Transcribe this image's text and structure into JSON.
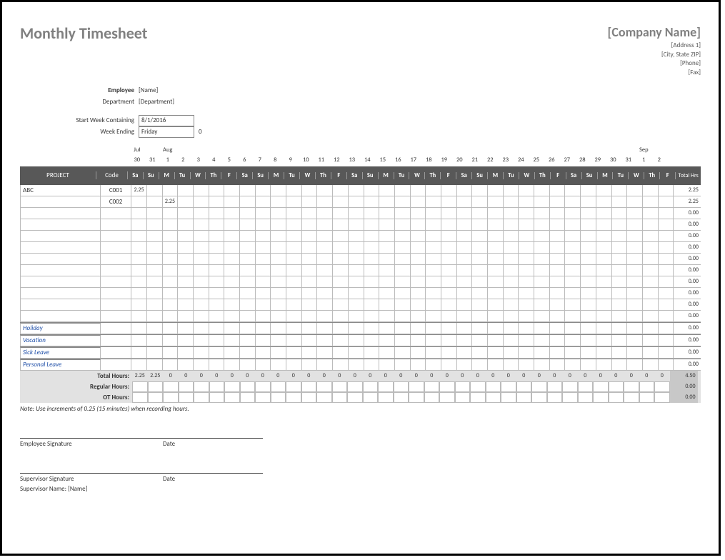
{
  "title": "Monthly Timesheet",
  "company": {
    "name": "[Company Name]",
    "addr1": "[Address 1]",
    "addr2": "[City, State ZIP]",
    "phone": "[Phone]",
    "fax": "[Fax]"
  },
  "meta": {
    "emp_lbl": "Employee",
    "emp_val": "[Name]",
    "dept_lbl": "Department",
    "dept_val": "[Department]",
    "start_lbl": "Start Week Containing",
    "start_val": "8/1/2016",
    "end_lbl": "Week Ending",
    "end_val": "Friday",
    "end_num": "0"
  },
  "months": [
    "Jul",
    "",
    "Aug",
    "",
    "",
    "",
    "",
    "",
    "",
    "",
    "",
    "",
    "",
    "",
    "",
    "",
    "",
    "",
    "",
    "",
    "",
    "",
    "",
    "",
    "",
    "",
    "",
    "",
    "",
    "",
    "",
    "",
    "",
    "Sep",
    ""
  ],
  "dates": [
    "30",
    "31",
    "1",
    "2",
    "3",
    "4",
    "5",
    "6",
    "7",
    "8",
    "9",
    "10",
    "11",
    "12",
    "13",
    "14",
    "15",
    "16",
    "17",
    "18",
    "19",
    "20",
    "21",
    "22",
    "23",
    "24",
    "25",
    "26",
    "27",
    "28",
    "29",
    "30",
    "31",
    "1",
    "2"
  ],
  "dow": [
    "Sa",
    "Su",
    "M",
    "Tu",
    "W",
    "Th",
    "F",
    "Sa",
    "Su",
    "M",
    "Tu",
    "W",
    "Th",
    "F",
    "Sa",
    "Su",
    "M",
    "Tu",
    "W",
    "Th",
    "F",
    "Sa",
    "Su",
    "M",
    "Tu",
    "W",
    "Th",
    "F",
    "Sa",
    "Su",
    "M",
    "Tu",
    "W",
    "Th",
    "F"
  ],
  "hdr": {
    "project": "PROJECT",
    "code": "Code",
    "total": "Total Hrs"
  },
  "rows": [
    {
      "project": "ABC",
      "code": "C001",
      "cells": [
        "2.25",
        "",
        "",
        "",
        "",
        "",
        "",
        "",
        "",
        "",
        "",
        "",
        "",
        "",
        "",
        "",
        "",
        "",
        "",
        "",
        "",
        "",
        "",
        "",
        "",
        "",
        "",
        "",
        "",
        "",
        "",
        "",
        "",
        "",
        ""
      ],
      "total": "2.25"
    },
    {
      "project": "",
      "code": "C002",
      "cells": [
        "",
        "",
        "2.25",
        "",
        "",
        "",
        "",
        "",
        "",
        "",
        "",
        "",
        "",
        "",
        "",
        "",
        "",
        "",
        "",
        "",
        "",
        "",
        "",
        "",
        "",
        "",
        "",
        "",
        "",
        "",
        "",
        "",
        "",
        "",
        ""
      ],
      "total": "2.25"
    },
    {
      "project": "",
      "code": "",
      "cells": [
        "",
        "",
        "",
        "",
        "",
        "",
        "",
        "",
        "",
        "",
        "",
        "",
        "",
        "",
        "",
        "",
        "",
        "",
        "",
        "",
        "",
        "",
        "",
        "",
        "",
        "",
        "",
        "",
        "",
        "",
        "",
        "",
        "",
        "",
        ""
      ],
      "total": "0.00"
    },
    {
      "project": "",
      "code": "",
      "cells": [
        "",
        "",
        "",
        "",
        "",
        "",
        "",
        "",
        "",
        "",
        "",
        "",
        "",
        "",
        "",
        "",
        "",
        "",
        "",
        "",
        "",
        "",
        "",
        "",
        "",
        "",
        "",
        "",
        "",
        "",
        "",
        "",
        "",
        "",
        ""
      ],
      "total": "0.00"
    },
    {
      "project": "",
      "code": "",
      "cells": [
        "",
        "",
        "",
        "",
        "",
        "",
        "",
        "",
        "",
        "",
        "",
        "",
        "",
        "",
        "",
        "",
        "",
        "",
        "",
        "",
        "",
        "",
        "",
        "",
        "",
        "",
        "",
        "",
        "",
        "",
        "",
        "",
        "",
        "",
        ""
      ],
      "total": "0.00"
    },
    {
      "project": "",
      "code": "",
      "cells": [
        "",
        "",
        "",
        "",
        "",
        "",
        "",
        "",
        "",
        "",
        "",
        "",
        "",
        "",
        "",
        "",
        "",
        "",
        "",
        "",
        "",
        "",
        "",
        "",
        "",
        "",
        "",
        "",
        "",
        "",
        "",
        "",
        "",
        "",
        ""
      ],
      "total": "0.00"
    },
    {
      "project": "",
      "code": "",
      "cells": [
        "",
        "",
        "",
        "",
        "",
        "",
        "",
        "",
        "",
        "",
        "",
        "",
        "",
        "",
        "",
        "",
        "",
        "",
        "",
        "",
        "",
        "",
        "",
        "",
        "",
        "",
        "",
        "",
        "",
        "",
        "",
        "",
        "",
        "",
        ""
      ],
      "total": "0.00"
    },
    {
      "project": "",
      "code": "",
      "cells": [
        "",
        "",
        "",
        "",
        "",
        "",
        "",
        "",
        "",
        "",
        "",
        "",
        "",
        "",
        "",
        "",
        "",
        "",
        "",
        "",
        "",
        "",
        "",
        "",
        "",
        "",
        "",
        "",
        "",
        "",
        "",
        "",
        "",
        "",
        ""
      ],
      "total": "0.00"
    },
    {
      "project": "",
      "code": "",
      "cells": [
        "",
        "",
        "",
        "",
        "",
        "",
        "",
        "",
        "",
        "",
        "",
        "",
        "",
        "",
        "",
        "",
        "",
        "",
        "",
        "",
        "",
        "",
        "",
        "",
        "",
        "",
        "",
        "",
        "",
        "",
        "",
        "",
        "",
        "",
        ""
      ],
      "total": "0.00"
    },
    {
      "project": "",
      "code": "",
      "cells": [
        "",
        "",
        "",
        "",
        "",
        "",
        "",
        "",
        "",
        "",
        "",
        "",
        "",
        "",
        "",
        "",
        "",
        "",
        "",
        "",
        "",
        "",
        "",
        "",
        "",
        "",
        "",
        "",
        "",
        "",
        "",
        "",
        "",
        "",
        ""
      ],
      "total": "0.00"
    },
    {
      "project": "",
      "code": "",
      "cells": [
        "",
        "",
        "",
        "",
        "",
        "",
        "",
        "",
        "",
        "",
        "",
        "",
        "",
        "",
        "",
        "",
        "",
        "",
        "",
        "",
        "",
        "",
        "",
        "",
        "",
        "",
        "",
        "",
        "",
        "",
        "",
        "",
        "",
        "",
        ""
      ],
      "total": "0.00"
    },
    {
      "project": "",
      "code": "",
      "cells": [
        "",
        "",
        "",
        "",
        "",
        "",
        "",
        "",
        "",
        "",
        "",
        "",
        "",
        "",
        "",
        "",
        "",
        "",
        "",
        "",
        "",
        "",
        "",
        "",
        "",
        "",
        "",
        "",
        "",
        "",
        "",
        "",
        "",
        "",
        ""
      ],
      "total": "0.00"
    }
  ],
  "leave": [
    {
      "label": "Holiday",
      "total": "0.00"
    },
    {
      "label": "Vacation",
      "total": "0.00"
    },
    {
      "label": "Sick Leave",
      "total": "0.00"
    },
    {
      "label": "Personal Leave",
      "total": "0.00"
    }
  ],
  "totals": {
    "total_lbl": "Total Hours:",
    "total_cells": [
      "2.25",
      "2.25",
      "0",
      "0",
      "0",
      "0",
      "0",
      "0",
      "0",
      "0",
      "0",
      "0",
      "0",
      "0",
      "0",
      "0",
      "0",
      "0",
      "0",
      "0",
      "0",
      "0",
      "0",
      "0",
      "0",
      "0",
      "0",
      "0",
      "0",
      "0",
      "0",
      "0",
      "0",
      "0",
      "0"
    ],
    "total_sum": "4.50",
    "reg_lbl": "Regular Hours:",
    "reg_sum": "0.00",
    "ot_lbl": "OT Hours:",
    "ot_sum": "0.00"
  },
  "note": "Note: Use increments of 0.25 (15 minutes) when recording hours.",
  "sig": {
    "emp": "Employee Signature",
    "sup": "Supervisor Signature",
    "date": "Date",
    "supname_lbl": "Supervisor Name:",
    "supname_val": "[Name]"
  }
}
